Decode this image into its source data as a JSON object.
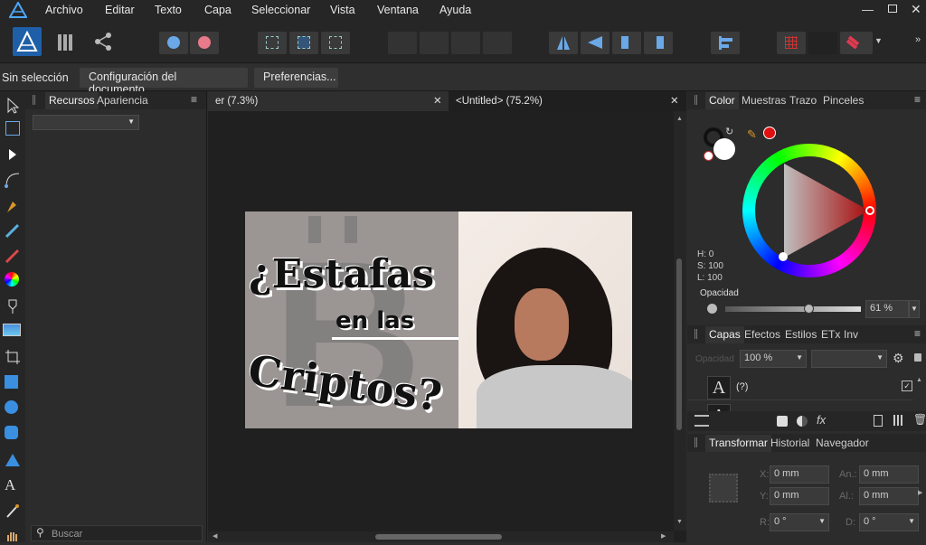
{
  "menu": [
    "Archivo",
    "Editar",
    "Texto",
    "Capa",
    "Seleccionar",
    "Vista",
    "Ventana",
    "Ayuda"
  ],
  "context": {
    "status": "Sin selección",
    "doc_setup": "Configuración del documento...",
    "prefs": "Preferencias..."
  },
  "assets_panel": {
    "tabs": [
      "Recursos",
      "Apariencia"
    ],
    "search_placeholder": "Buscar"
  },
  "documents": [
    {
      "title": "er (7.3%)"
    },
    {
      "title": "<Untitled> (75.2%)"
    }
  ],
  "artwork": {
    "line1": "¿Estafas",
    "line2": "en las",
    "line3": "Criptos?"
  },
  "color_panel": {
    "tabs": [
      "Color",
      "Muestras",
      "Trazo",
      "Pinceles"
    ],
    "h": "H: 0",
    "s": "S: 100",
    "l": "L: 100",
    "opacity_label": "Opacidad",
    "opacity_value": "61 %",
    "opacity_fraction": 0.61,
    "accent": "#e01010"
  },
  "layers_panel": {
    "tabs": [
      "Capas",
      "Efectos",
      "Estilos",
      "ETx",
      "Inv"
    ],
    "opacity_label": "Opacidad",
    "opacity_value": "100 %",
    "layer_name": "(?)"
  },
  "transform_panel": {
    "tabs": [
      "Transformar",
      "Historial",
      "Navegador"
    ],
    "fields": [
      {
        "label": "X:",
        "value": "0 mm"
      },
      {
        "label": "An.:",
        "value": "0 mm"
      },
      {
        "label": "Y:",
        "value": "0 mm"
      },
      {
        "label": "Al.:",
        "value": "0 mm"
      },
      {
        "label": "R:",
        "value": "0 °"
      },
      {
        "label": "D:",
        "value": "0 °"
      }
    ]
  }
}
